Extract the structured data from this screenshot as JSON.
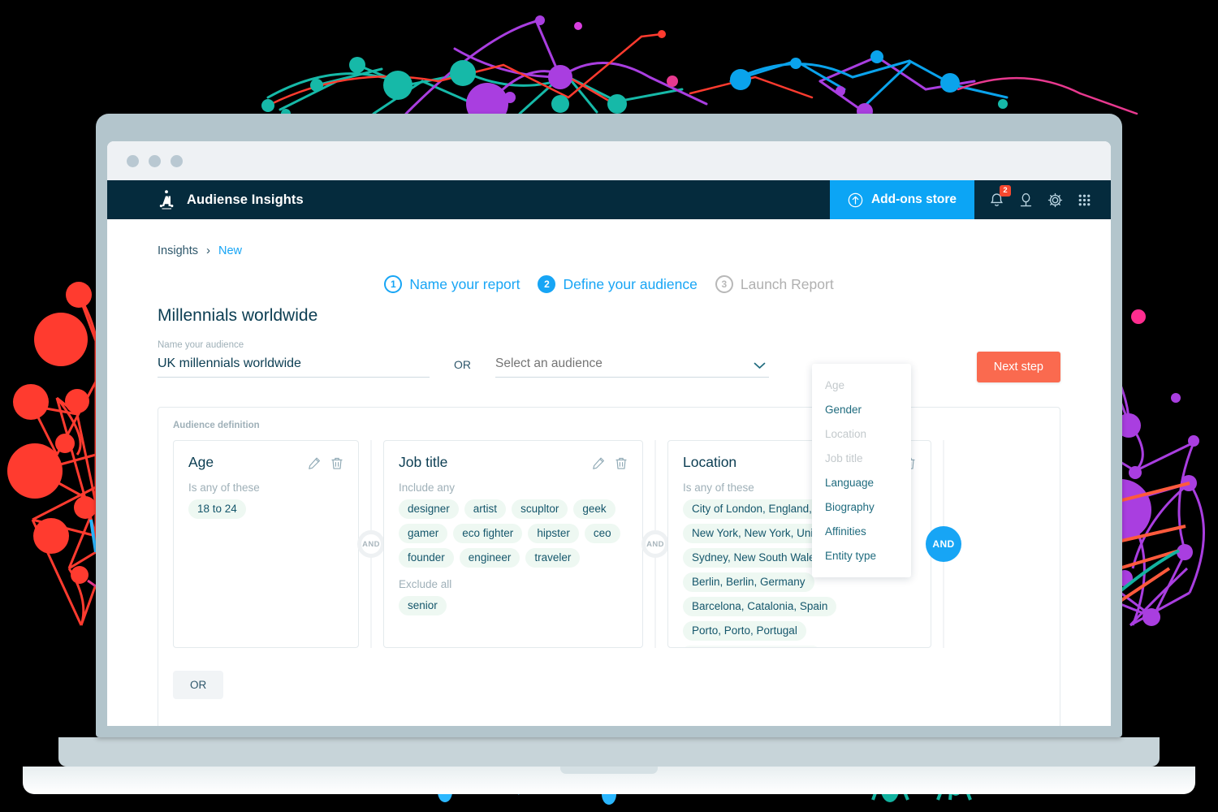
{
  "window": {
    "dots": [
      "close-dot",
      "minimize-dot",
      "maximize-dot"
    ]
  },
  "header": {
    "brand": "Audiense Insights",
    "logo_icon": "audiense-a-logo",
    "addons_label": "Add-ons store",
    "addons_icon": "arrow-up-circle-icon",
    "icons": [
      {
        "name": "notifications-bell-icon",
        "badge": "2"
      },
      {
        "name": "user-avatar-icon",
        "badge": ""
      },
      {
        "name": "gear-icon",
        "badge": ""
      },
      {
        "name": "apps-grid-icon",
        "badge": ""
      }
    ]
  },
  "breadcrumb": {
    "root": "Insights",
    "separator": "›",
    "current": "New"
  },
  "steps": [
    {
      "number": "1",
      "label": "Name your report",
      "state": "done"
    },
    {
      "number": "2",
      "label": "Define your audience",
      "state": "active"
    },
    {
      "number": "3",
      "label": "Launch Report",
      "state": "inactive"
    }
  ],
  "report": {
    "title": "Millennials worldwide",
    "name_label": "Name your audience",
    "name_value": "UK millennials worldwide",
    "or_separator": "OR",
    "select_placeholder": "Select an audience",
    "select_icon": "chevron-down-icon",
    "next_step_label": "Next step"
  },
  "definition": {
    "section_label": "Audience definition",
    "or_button_label": "OR",
    "cards": [
      {
        "title": "Age",
        "condition": "Is any of these",
        "tags": [
          "18 to 24"
        ],
        "edit_icon": "pencil-icon",
        "delete_icon": "trash-icon"
      },
      {
        "title": "Job title",
        "condition": "Include any",
        "tags": [
          "designer",
          "artist",
          "scupltor",
          "geek",
          "gamer",
          "eco fighter",
          "hipster",
          "ceo",
          "founder",
          "engineer",
          "traveler"
        ],
        "exclude_label": "Exclude all",
        "exclude_tags": [
          "senior"
        ],
        "edit_icon": "pencil-icon",
        "delete_icon": "trash-icon"
      },
      {
        "title": "Location",
        "condition": "Is any of these",
        "tags": [
          "City of London, England, United Kingdom",
          "New York, New York, United States",
          "Sydney, New South Wales, Australia",
          "Berlin, Berlin, Germany",
          "Barcelona, Catalonia, Spain",
          "Porto, Porto, Portugal"
        ],
        "edit_icon": "pencil-icon",
        "delete_icon": "trash-icon"
      }
    ],
    "connectors": [
      {
        "label": "AND",
        "state": "idle"
      },
      {
        "label": "AND",
        "state": "idle"
      },
      {
        "label": "AND",
        "state": "active"
      }
    ]
  },
  "dropdown": {
    "items": [
      {
        "label": "Age",
        "disabled": true
      },
      {
        "label": "Gender",
        "disabled": false
      },
      {
        "label": "Location",
        "disabled": true
      },
      {
        "label": "Job title",
        "disabled": true
      },
      {
        "label": "Language",
        "disabled": false
      },
      {
        "label": "Biography",
        "disabled": false
      },
      {
        "label": "Affinities",
        "disabled": false
      },
      {
        "label": "Entity type",
        "disabled": false
      }
    ]
  },
  "colors": {
    "header_bg": "#052b3d",
    "accent_blue": "#17a5f5",
    "addons_blue": "#0ca5f5",
    "cta_orange": "#fa6a4f",
    "tag_bg": "#eef8f2",
    "tag_text": "#14566b",
    "badge_red": "#f6482f"
  }
}
